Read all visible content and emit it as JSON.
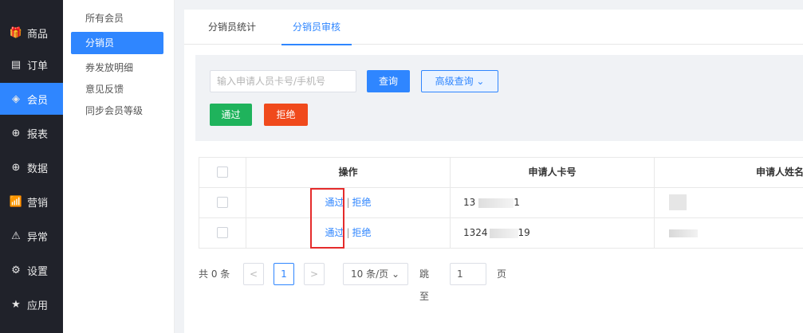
{
  "nav": {
    "items": [
      {
        "icon": "gift-icon",
        "glyph": "🎁",
        "label": "商品"
      },
      {
        "icon": "order-icon",
        "glyph": "▤",
        "label": "订单"
      },
      {
        "icon": "member-icon",
        "glyph": "◈",
        "label": "会员",
        "active": true
      },
      {
        "icon": "report-icon",
        "glyph": "⊕",
        "label": "报表"
      },
      {
        "icon": "data-icon",
        "glyph": "⊕",
        "label": "数据"
      },
      {
        "icon": "marketing-icon",
        "glyph": "📶",
        "label": "营销"
      },
      {
        "icon": "warning-icon",
        "glyph": "⚠",
        "label": "异常"
      },
      {
        "icon": "gear-icon",
        "glyph": "⚙",
        "label": "设置"
      },
      {
        "icon": "star-icon",
        "glyph": "★",
        "label": "应用"
      }
    ]
  },
  "subnav": {
    "items": [
      {
        "label": "所有会员"
      },
      {
        "label": "分销员",
        "active": true
      },
      {
        "label": "券发放明细"
      },
      {
        "label": "意见反馈"
      },
      {
        "label": "同步会员等级"
      }
    ]
  },
  "tabs": [
    {
      "label": "分销员统计"
    },
    {
      "label": "分销员审核",
      "active": true
    }
  ],
  "filter": {
    "search_placeholder": "输入申请人员卡号/手机号",
    "query_label": "查询",
    "advanced_label": "高级查询 ⌄",
    "pass_label": "通过",
    "reject_label": "拒绝"
  },
  "table": {
    "headers": {
      "op": "操作",
      "card": "申请人卡号",
      "name": "申请人姓名"
    },
    "rows": [
      {
        "pass": "通过",
        "sep": "|",
        "reject": "拒绝",
        "card_prefix": "13",
        "card_suffix": "1"
      },
      {
        "pass": "通过",
        "sep": "|",
        "reject": "拒绝",
        "card_prefix": "1324",
        "card_suffix": "19"
      }
    ]
  },
  "pager": {
    "total": "共 0 条",
    "prev": "<",
    "current": "1",
    "next": ">",
    "page_size": "10 条/页 ⌄",
    "jump_label": "跳至",
    "jump_value": "1",
    "page_label": "页"
  },
  "colors": {
    "nav_bg": "#20222a",
    "accent": "#2f86ff",
    "pass": "#1fb35c",
    "reject": "#f04a1c",
    "highlight": "#e52b2b"
  }
}
